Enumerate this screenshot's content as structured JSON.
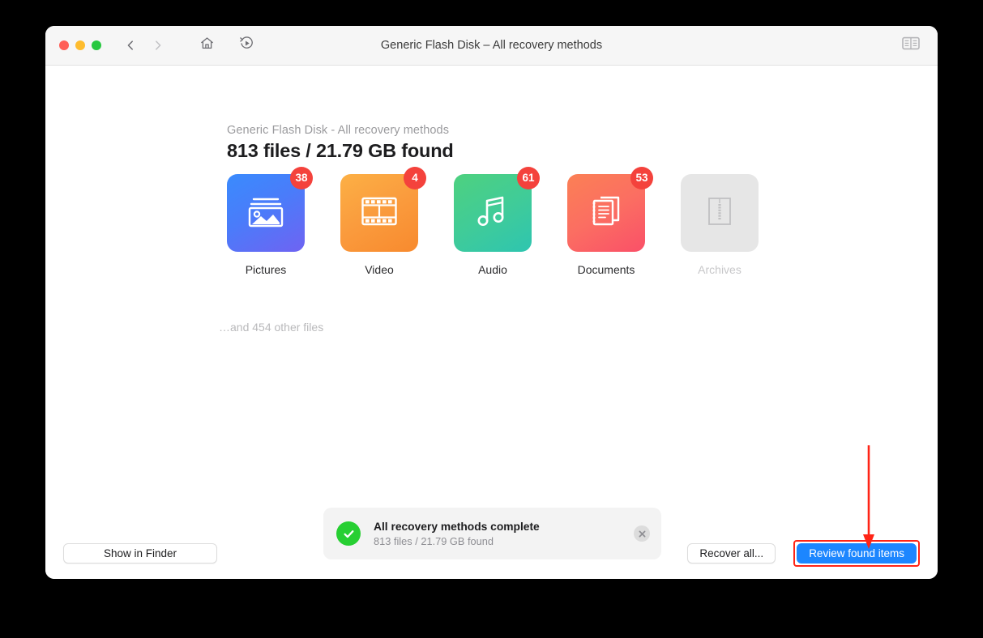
{
  "window": {
    "title": "Generic Flash Disk – All recovery methods",
    "traffic_lights": [
      "close",
      "minimize",
      "zoom"
    ],
    "nav": {
      "back_icon": "chevron-left-icon",
      "forward_icon": "chevron-right-icon",
      "home_icon": "home-icon",
      "rescan_icon": "rescan-play-icon"
    },
    "panel_toggle_icon": "sidebar-panel-icon"
  },
  "header": {
    "subtitle": "Generic Flash Disk - All recovery methods",
    "title": "813 files / 21.79 GB found"
  },
  "categories": [
    {
      "label": "Pictures",
      "badge": "38",
      "icon": "photo-icon",
      "disabled": false
    },
    {
      "label": "Video",
      "badge": "4",
      "icon": "film-icon",
      "disabled": false
    },
    {
      "label": "Audio",
      "badge": "61",
      "icon": "music-note-icon",
      "disabled": false
    },
    {
      "label": "Documents",
      "badge": "53",
      "icon": "documents-icon",
      "disabled": false
    },
    {
      "label": "Archives",
      "badge": "",
      "icon": "archive-zip-icon",
      "disabled": true
    }
  ],
  "other_files": "…and 454 other files",
  "toast": {
    "status_icon": "checkmark-circle-icon",
    "title": "All recovery methods complete",
    "subtitle": "813 files / 21.79 GB found",
    "close_icon": "close-circle-icon"
  },
  "footer": {
    "show_in_finder": "Show in Finder",
    "recover_all": "Recover all...",
    "review_found_items": "Review found items"
  },
  "annotation": {
    "arrow_icon": "red-down-arrow",
    "color": "#ff2416"
  },
  "colors": {
    "accent_blue": "#1c86ff",
    "badge_red": "#f4423c",
    "success_green": "#27cf32",
    "annotation_red": "#ff2416"
  }
}
